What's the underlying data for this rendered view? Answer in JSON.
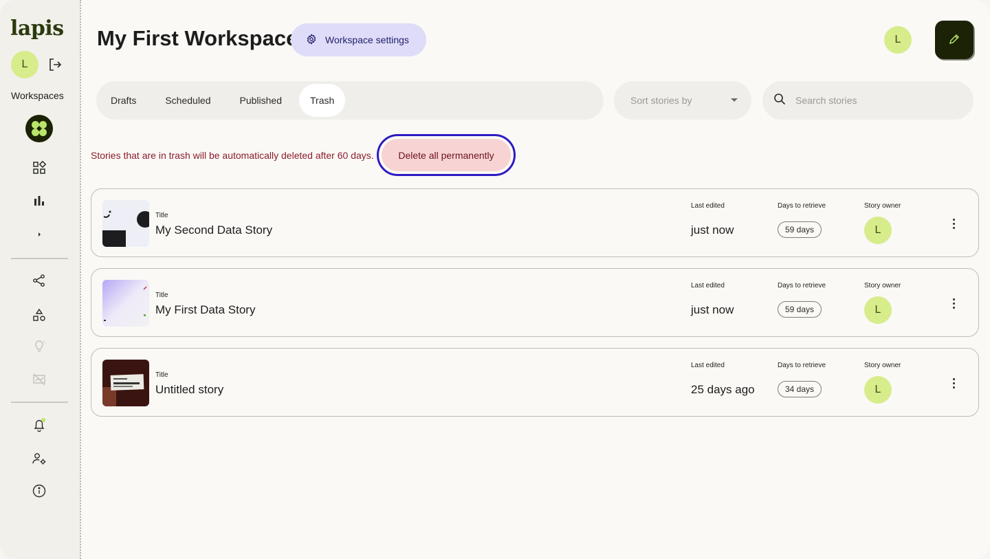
{
  "sidebar": {
    "logo": "lapis",
    "avatar_initial": "L",
    "workspaces_label": "Workspaces"
  },
  "header": {
    "title": "My First Workspace",
    "settings_label": "Workspace settings",
    "avatar_initial": "L"
  },
  "tabs": [
    "Drafts",
    "Scheduled",
    "Published",
    "Trash"
  ],
  "active_tab": "Trash",
  "sort": {
    "placeholder": "Sort stories by"
  },
  "search": {
    "placeholder": "Search stories"
  },
  "trash_notice": "Stories that are in trash will be automatically deleted after 60 days.",
  "delete_all_label": "Delete all permanently",
  "column_labels": {
    "title": "Title",
    "last_edited": "Last edited",
    "days_to_retrieve": "Days to retrieve",
    "story_owner": "Story owner"
  },
  "stories": [
    {
      "title": "My Second Data Story",
      "last_edited": "just now",
      "days": "59 days",
      "owner_initial": "L"
    },
    {
      "title": "My First Data Story",
      "last_edited": "just now",
      "days": "59 days",
      "owner_initial": "L"
    },
    {
      "title": "Untitled story",
      "last_edited": "25 days ago",
      "days": "34 days",
      "owner_initial": "L"
    }
  ],
  "colors": {
    "accent": "#d7ec8a",
    "settings_bg": "#dedcf8",
    "delete_bg": "#f7d4d3",
    "delete_outline": "#2e1bc2",
    "notice_text": "#8b1d2c"
  }
}
